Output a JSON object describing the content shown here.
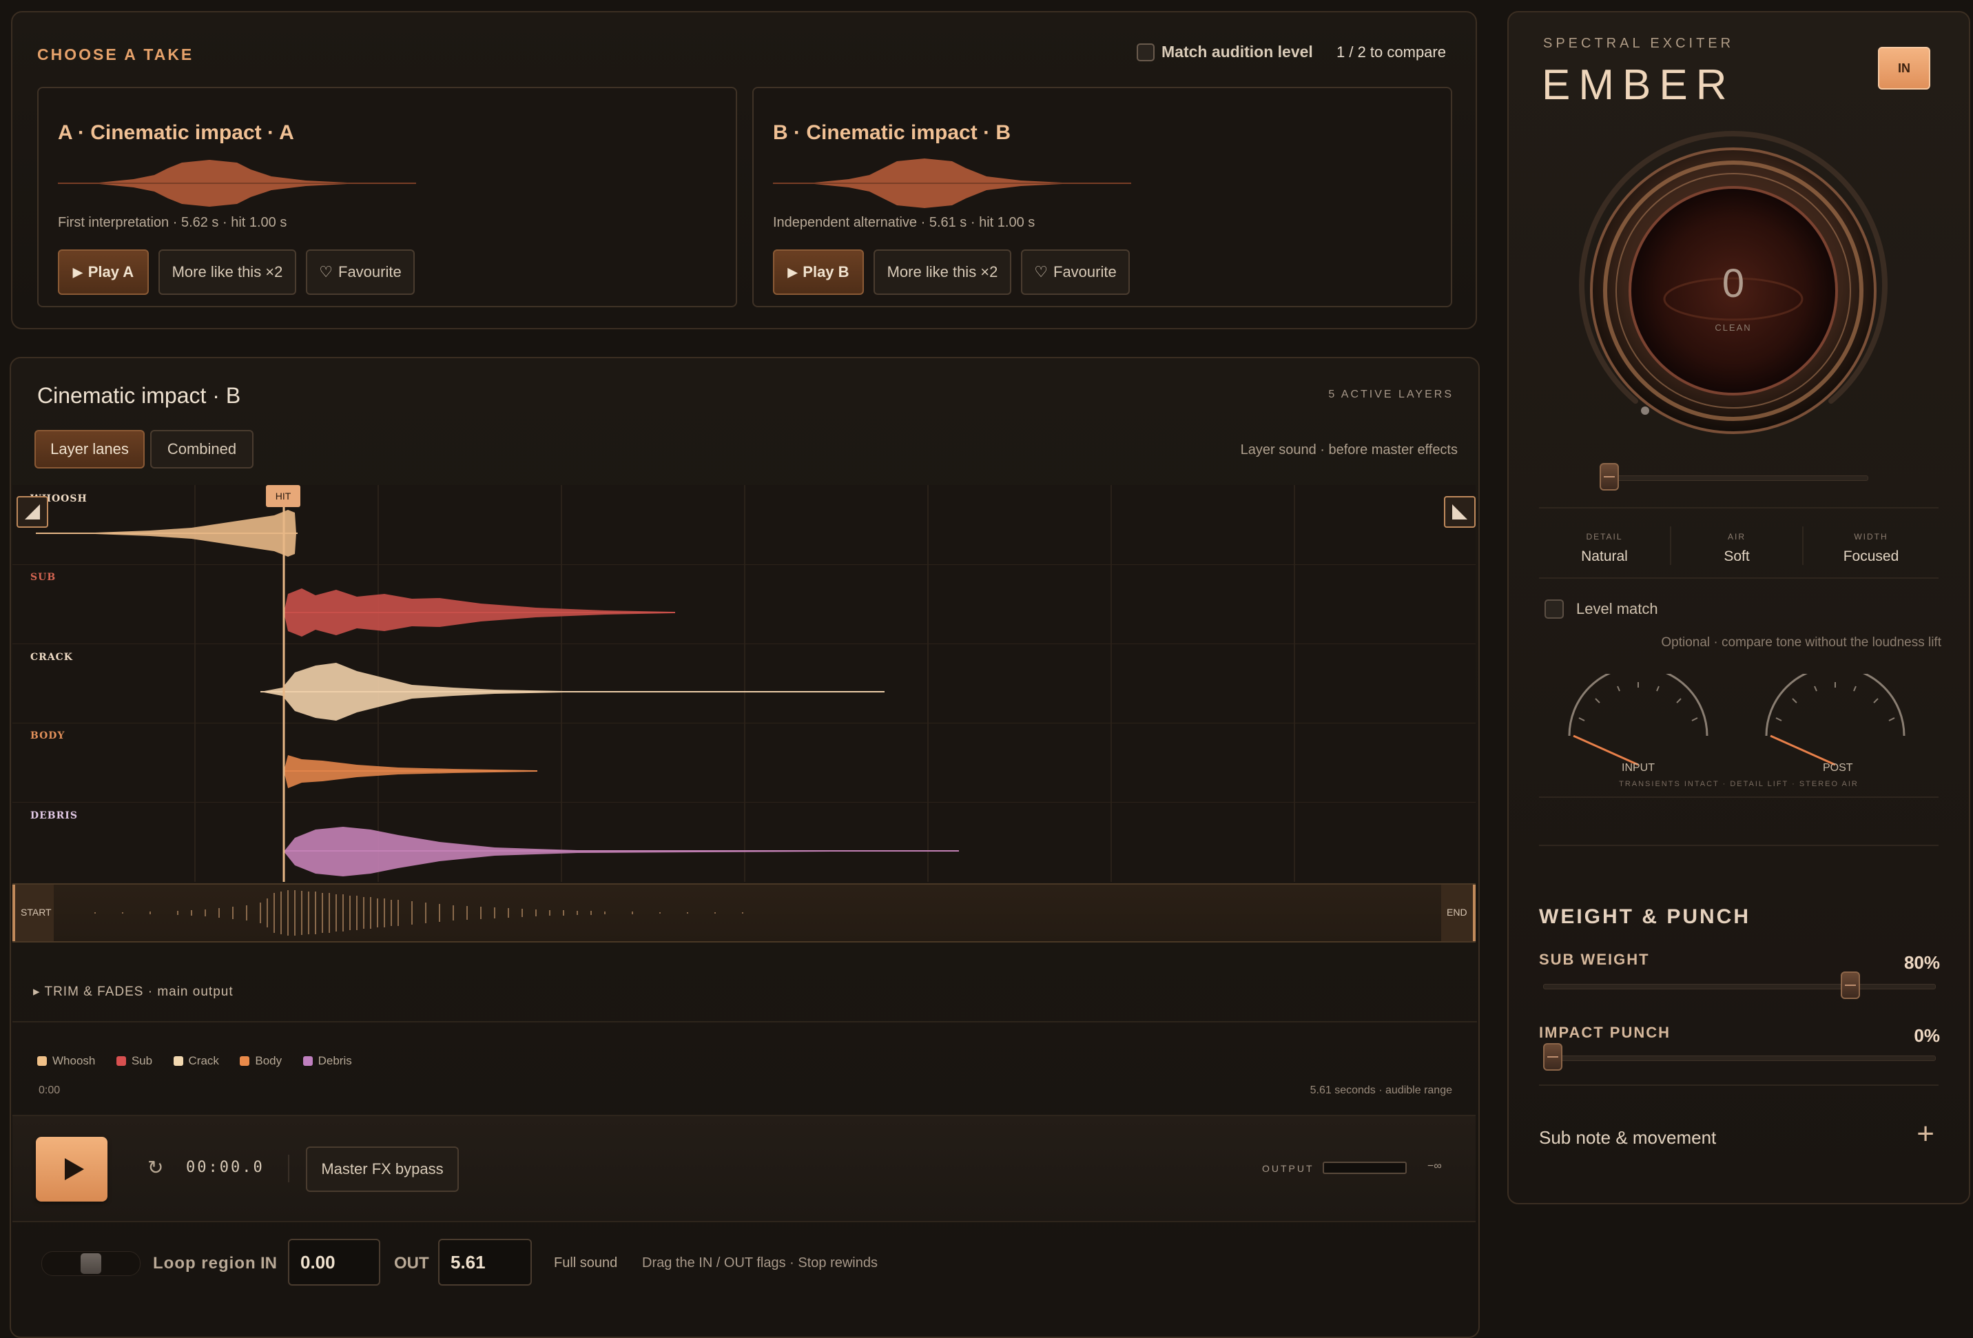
{
  "takes": {
    "heading": "CHOOSE A TAKE",
    "match_label": "Match audition level",
    "compare": "1 / 2 to compare",
    "cards": [
      {
        "title": "A · Cinematic impact · A",
        "meta": "First interpretation · 5.62 s · hit 1.00 s",
        "play": "Play A",
        "more": "More like this ×2",
        "fav": "Favourite"
      },
      {
        "title": "B · Cinematic impact · B",
        "meta": "Independent alternative · 5.61 s · hit 1.00 s",
        "play": "Play B",
        "more": "More like this ×2",
        "fav": "Favourite"
      }
    ]
  },
  "editor": {
    "title": "Cinematic impact · B",
    "active_layers": "5 ACTIVE LAYERS",
    "view_tabs": [
      "Layer lanes",
      "Combined"
    ],
    "hint": "Layer sound · before master effects",
    "hit_flag": "HIT",
    "lanes": [
      {
        "name": "WHOOSH",
        "color": "#e8b887"
      },
      {
        "name": "SUB",
        "color": "#c8504a"
      },
      {
        "name": "CRACK",
        "color": "#efcfaa"
      },
      {
        "name": "BODY",
        "color": "#e2844a"
      },
      {
        "name": "DEBRIS",
        "color": "#c481b6"
      }
    ],
    "overview_start": "START",
    "overview_end": "END",
    "trim_label": "▸ TRIM & FADES · main output",
    "legend": [
      {
        "name": "Whoosh",
        "color": "#f0c088"
      },
      {
        "name": "Sub",
        "color": "#d85050"
      },
      {
        "name": "Crack",
        "color": "#f2d8b0"
      },
      {
        "name": "Body",
        "color": "#e98a4a"
      },
      {
        "name": "Debris",
        "color": "#c080c0"
      }
    ],
    "time_start": "0:00",
    "duration": "5.61 seconds · audible range"
  },
  "transport": {
    "time": "00:00.0",
    "bypass": "Master FX bypass",
    "output_label": "OUTPUT",
    "output_value": "−∞"
  },
  "loop": {
    "label": "Loop region",
    "in_label": "IN",
    "in_value": "0.00",
    "out_label": "OUT",
    "out_value": "5.61",
    "full": "Full sound",
    "help": "Drag the IN / OUT flags · Stop rewinds"
  },
  "exciter": {
    "subtitle": "SPECTRAL EXCITER",
    "name": "EMBER",
    "in_button": "IN",
    "knob_value": "0",
    "knob_label": "CLEAN",
    "amount_slider": 0.0,
    "params": [
      {
        "label": "DETAIL",
        "value": "Natural"
      },
      {
        "label": "AIR",
        "value": "Soft"
      },
      {
        "label": "WIDTH",
        "value": "Focused"
      }
    ],
    "level_match": "Level match",
    "level_note": "Optional · compare tone without the loudness lift",
    "meters": [
      {
        "label": "INPUT"
      },
      {
        "label": "POST"
      }
    ],
    "meter_caption": "TRANSIENTS INTACT · DETAIL LIFT · STEREO AIR"
  },
  "weight": {
    "heading": "WEIGHT & PUNCH",
    "sub_label": "SUB WEIGHT",
    "sub_value": "80%",
    "sub_level": 0.8,
    "punch_label": "IMPACT PUNCH",
    "punch_value": "0%",
    "punch_level": 0.0,
    "sub_note": "Sub note & movement",
    "colors": {
      "accent": "#e89a5c",
      "panel": "#1d1813"
    }
  }
}
